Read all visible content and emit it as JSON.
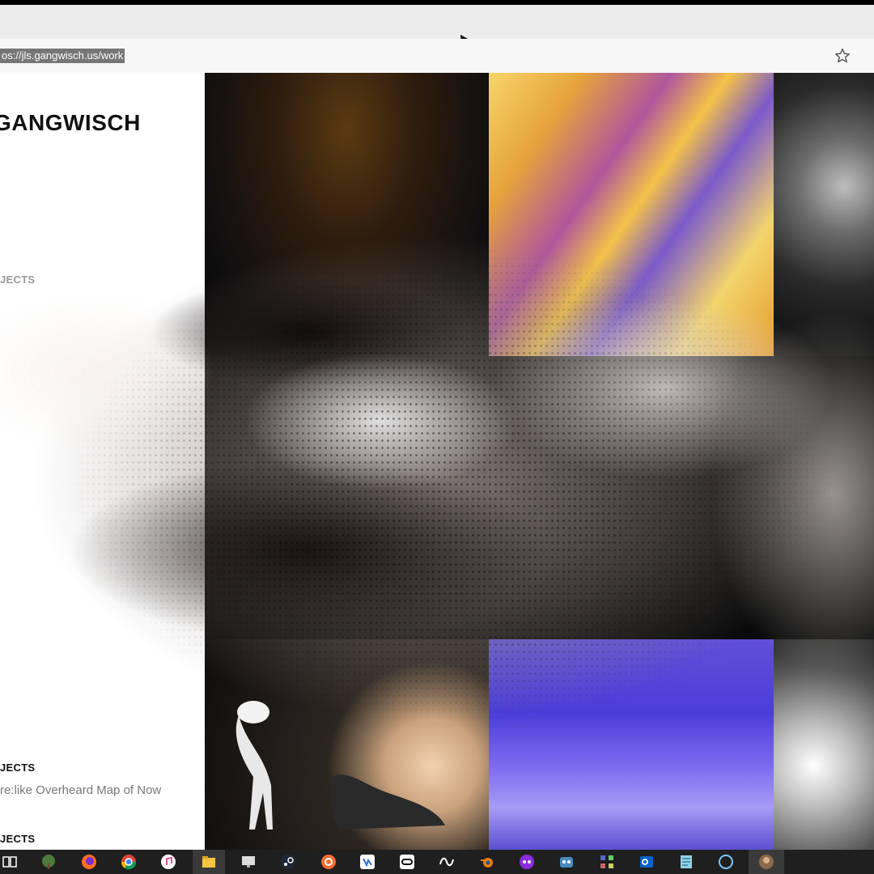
{
  "browser": {
    "url": "os://jls.gangwisch.us/work"
  },
  "sidebar": {
    "site_title": "GANGWISCH",
    "section_top_fragment": "JECTS",
    "section_heading_1": "JECTS",
    "project_link": "re:like Overheard Map of Now",
    "section_heading_2": "JECTS"
  },
  "taskbar": {
    "icons": [
      "task-view-icon",
      "tree-app-icon",
      "firefox-icon",
      "chrome-icon",
      "itunes-icon",
      "file-explorer-icon",
      "monitor-icon",
      "steam-icon",
      "origin-icon",
      "remote-app-icon",
      "oculus-icon",
      "meta-icon",
      "blender-icon",
      "purple-app-icon",
      "godot-icon",
      "pixel-app-icon",
      "outlook-icon",
      "notepad-icon",
      "cortana-icon",
      "avatar-icon"
    ]
  },
  "colors": {
    "chrome_bg": "#ececec",
    "address_bg": "#f7f7f7",
    "url_highlight": "#767676",
    "taskbar_bg": "#1f1f1f"
  }
}
